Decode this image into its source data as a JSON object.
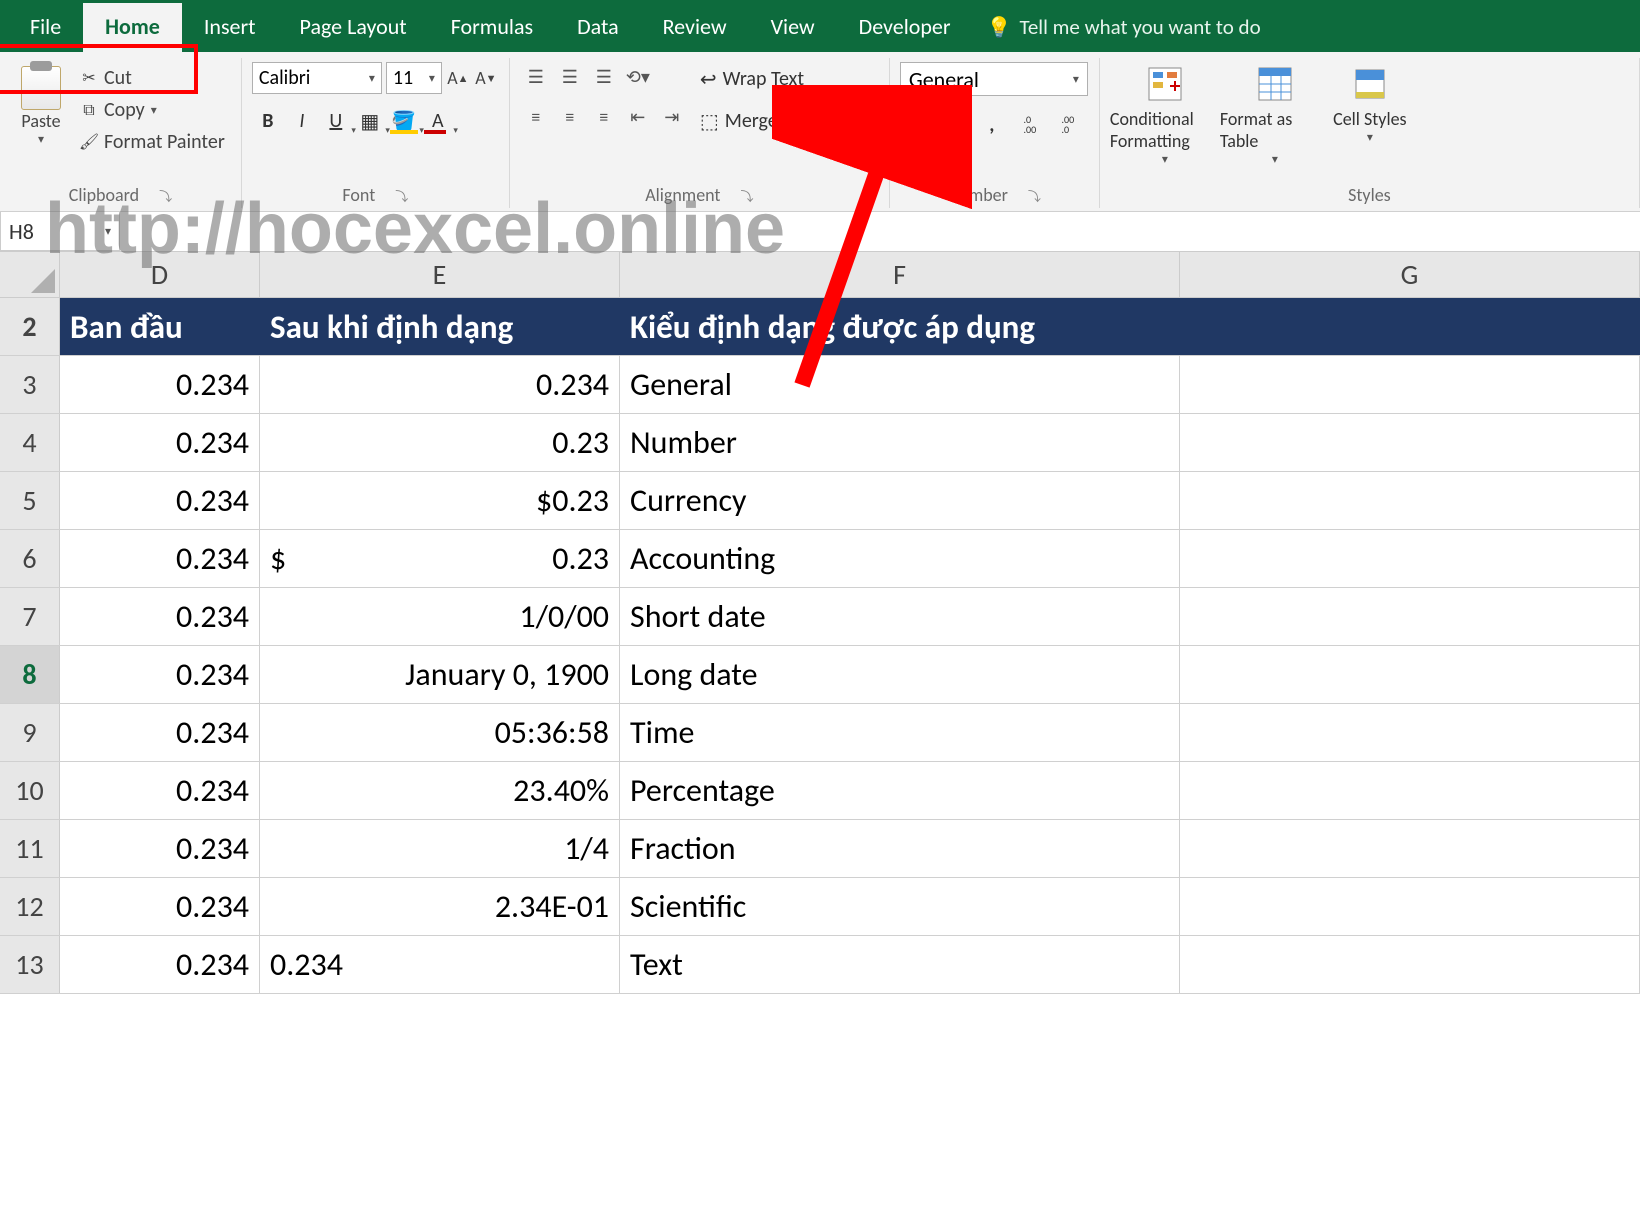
{
  "tabs": {
    "file": "File",
    "home": "Home",
    "insert": "Insert",
    "layout": "Page Layout",
    "formulas": "Formulas",
    "data": "Data",
    "review": "Review",
    "view": "View",
    "developer": "Developer"
  },
  "tellme": "Tell me what you want to do",
  "ribbon": {
    "clipboard": {
      "paste": "Paste",
      "cut": "Cut",
      "copy": "Copy",
      "painter": "Format Painter",
      "label": "Clipboard"
    },
    "font": {
      "name": "Calibri",
      "size": "11",
      "label": "Font"
    },
    "alignment": {
      "wrap": "Wrap Text",
      "merge": "Merge & Center",
      "label": "Alignment"
    },
    "number": {
      "format": "General",
      "label": "Number"
    },
    "styles": {
      "cond": "Conditional Formatting",
      "fat": "Format as Table",
      "cell": "Cell Styles",
      "label": "Styles"
    }
  },
  "namebox": "H8",
  "watermark": "http://hocexcel.online",
  "columns": {
    "D": "D",
    "E": "E",
    "F": "F",
    "G": "G"
  },
  "header_row": {
    "num": "2",
    "D": "Ban đầu",
    "E": "Sau khi định dạng",
    "F": "Kiểu định dạng được áp dụng"
  },
  "rows": [
    {
      "num": "3",
      "D": "0.234",
      "E": "0.234",
      "F": "General",
      "acct": false,
      "textleft": false
    },
    {
      "num": "4",
      "D": "0.234",
      "E": "0.23",
      "F": "Number",
      "acct": false,
      "textleft": false
    },
    {
      "num": "5",
      "D": "0.234",
      "E": "$0.23",
      "F": "Currency",
      "acct": false,
      "textleft": false
    },
    {
      "num": "6",
      "D": "0.234",
      "E_left": "$",
      "E_right": "0.23",
      "F": "Accounting",
      "acct": true,
      "textleft": false
    },
    {
      "num": "7",
      "D": "0.234",
      "E": "1/0/00",
      "F": "Short date",
      "acct": false,
      "textleft": false
    },
    {
      "num": "8",
      "D": "0.234",
      "E": "January 0, 1900",
      "F": "Long date",
      "acct": false,
      "textleft": false,
      "sel": true
    },
    {
      "num": "9",
      "D": "0.234",
      "E": "05:36:58",
      "F": "Time",
      "acct": false,
      "textleft": false
    },
    {
      "num": "10",
      "D": "0.234",
      "E": "23.40%",
      "F": "Percentage",
      "acct": false,
      "textleft": false
    },
    {
      "num": "11",
      "D": "0.234",
      "E": "1/4",
      "F": "Fraction",
      "acct": false,
      "textleft": false
    },
    {
      "num": "12",
      "D": "0.234",
      "E": "2.34E-01",
      "F": "Scientific",
      "acct": false,
      "textleft": false
    },
    {
      "num": "13",
      "D": "0.234",
      "E": "0.234",
      "F": "Text",
      "acct": false,
      "textleft": true
    }
  ]
}
